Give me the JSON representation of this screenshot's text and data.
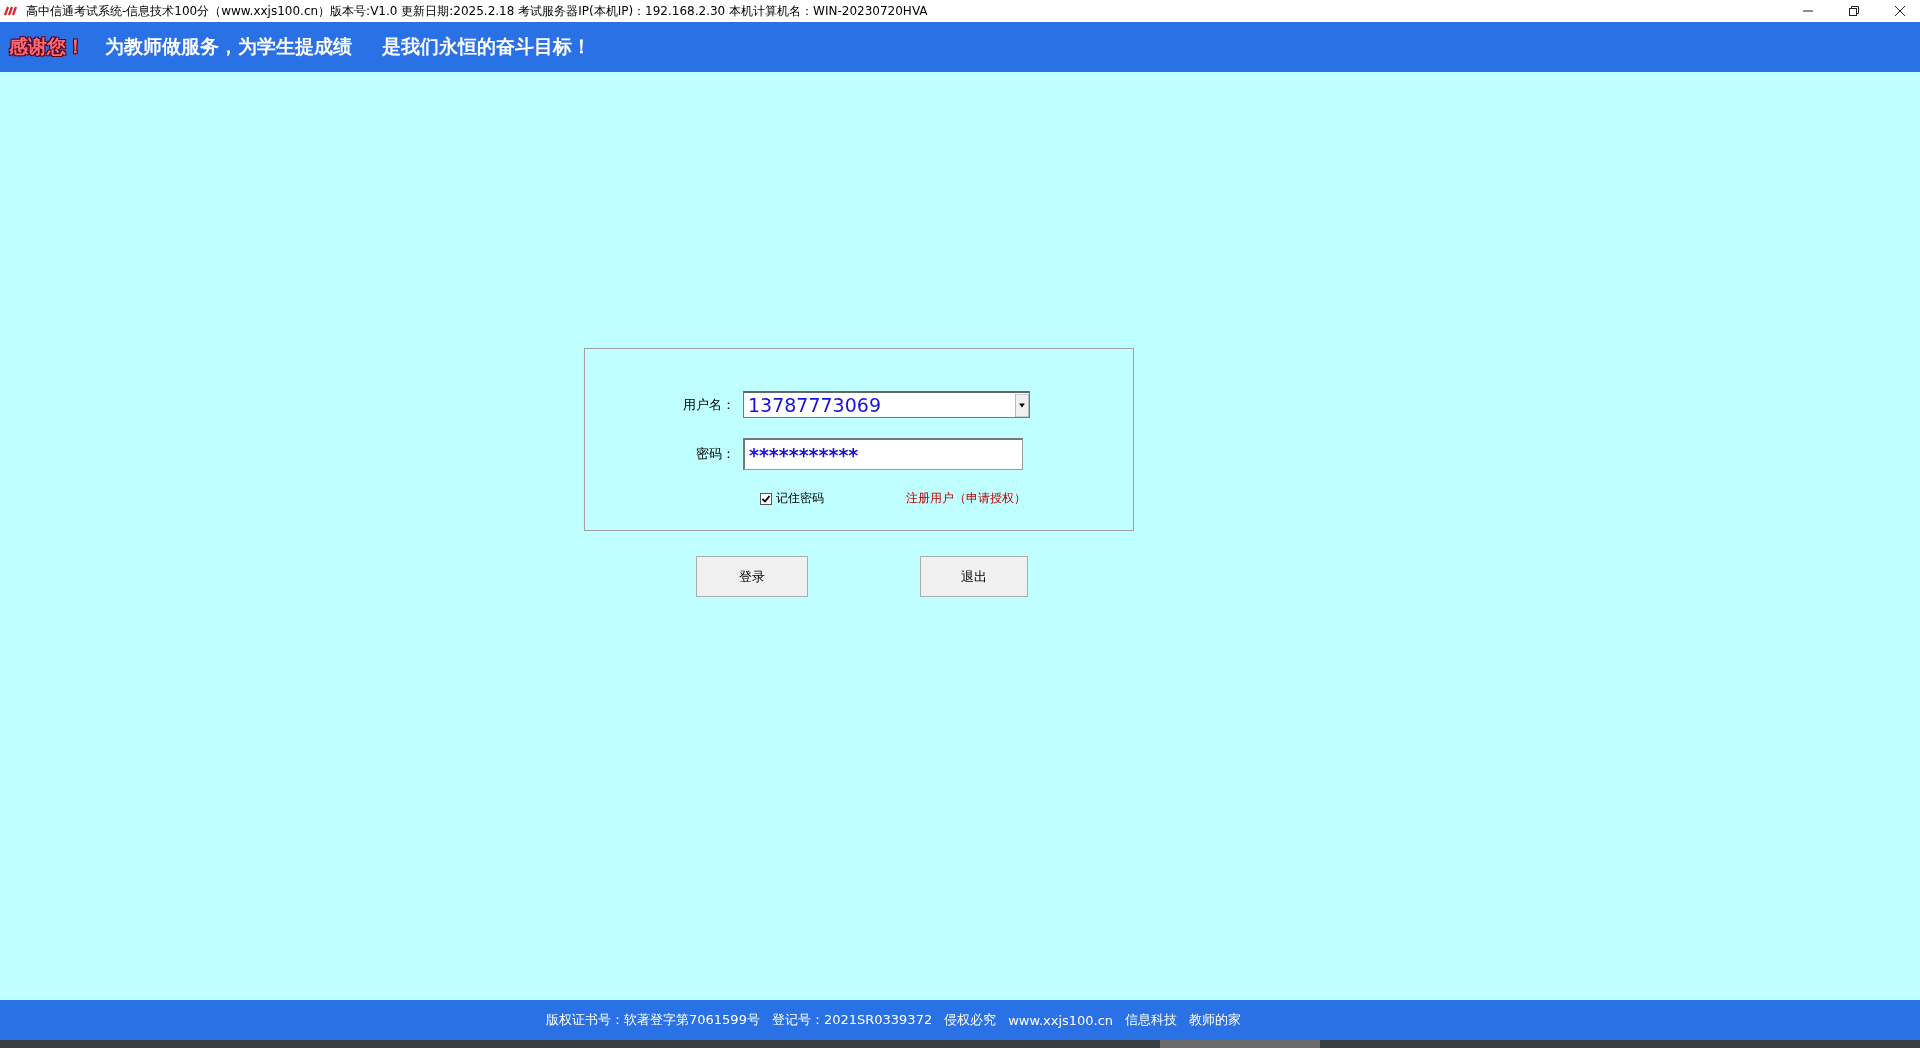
{
  "window": {
    "title": "高中信通考试系统-信息技术100分（www.xxjs100.cn）版本号:V1.0 更新日期:2025.2.18  考试服务器IP(本机IP)：192.168.2.30 本机计算机名：WIN-20230720HVA"
  },
  "banner": {
    "greeting": "感谢您！",
    "slogans": [
      "为教师做服务，为学生提成绩",
      "是我们永恒的奋斗目标！"
    ]
  },
  "login": {
    "username": {
      "label": "用户名：",
      "value": "13787773069"
    },
    "password": {
      "label": "密码：",
      "value": "***********"
    },
    "remember": {
      "label": "记住密码",
      "checked": true
    },
    "register_link": "注册用户（申请授权）"
  },
  "buttons": [
    "登录",
    "退出"
  ],
  "footer": [
    "版权证书号：软著登字第7061599号",
    "登记号：2021SR0339372",
    "侵权必究",
    "www.xxjs100.cn",
    "信息科技",
    "教师的家"
  ]
}
